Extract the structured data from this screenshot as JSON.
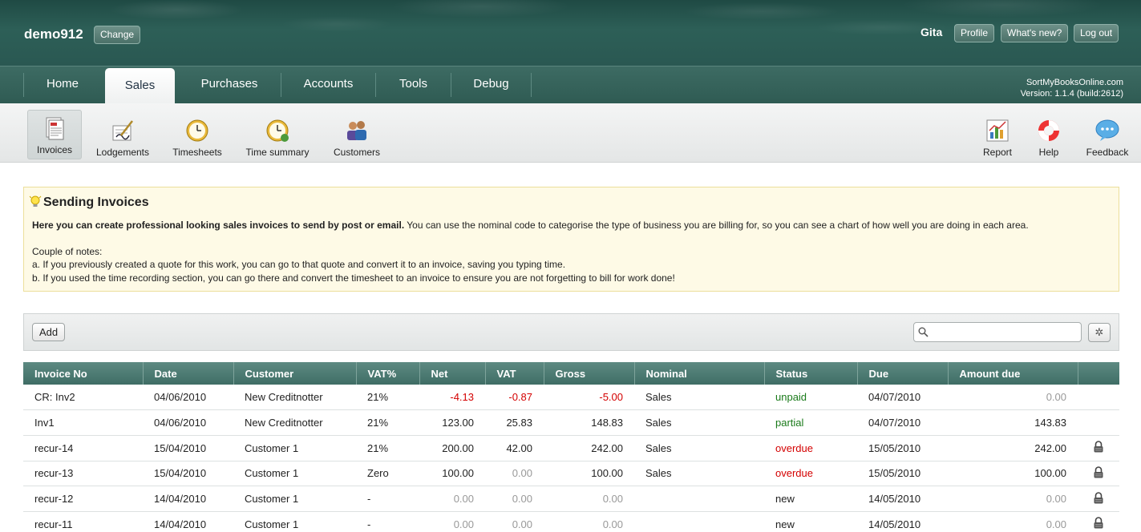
{
  "header": {
    "company": "demo912",
    "change_label": "Change",
    "user": "Gita",
    "profile_label": "Profile",
    "whats_new_label": "What's new?",
    "logout_label": "Log out"
  },
  "nav": {
    "tabs": [
      "Home",
      "Sales",
      "Purchases",
      "Accounts",
      "Tools",
      "Debug"
    ],
    "active": "Sales",
    "product": "SortMyBooksOnline.com",
    "version": "Version: 1.1.4 (build:2612)"
  },
  "toolbar": {
    "items": [
      {
        "label": "Invoices",
        "icon": "invoices-icon"
      },
      {
        "label": "Lodgements",
        "icon": "lodgements-icon"
      },
      {
        "label": "Timesheets",
        "icon": "clock-icon"
      },
      {
        "label": "Time summary",
        "icon": "clock-summary-icon"
      },
      {
        "label": "Customers",
        "icon": "customers-icon"
      }
    ],
    "right_items": [
      {
        "label": "Report",
        "icon": "report-chart-icon"
      },
      {
        "label": "Help",
        "icon": "lifebuoy-icon"
      },
      {
        "label": "Feedback",
        "icon": "speech-bubble-icon"
      }
    ]
  },
  "info": {
    "title": "Sending Invoices",
    "lead_bold": "Here you can create professional looking sales invoices to send by post or email.",
    "lead_rest": " You can use the nominal code to categorise the type of business you are billing for, so you can see a chart of how well you are doing in each area.",
    "notes_heading": "Couple of notes:",
    "note_a": "a. If you previously created a quote for this work, you can go to that quote and convert it to an invoice, saving you typing time.",
    "note_b": "b. If you used the time recording section, you can go there and convert the timesheet to an invoice to ensure you are not forgetting to bill for work done!"
  },
  "actions": {
    "add_label": "Add",
    "search_placeholder": ""
  },
  "table": {
    "columns": [
      "Invoice No",
      "Date",
      "Customer",
      "VAT%",
      "Net",
      "VAT",
      "Gross",
      "Nominal",
      "Status",
      "Due",
      "Amount due",
      ""
    ],
    "rows": [
      {
        "invoice": "CR: Inv2",
        "date": "04/06/2010",
        "customer": "New Creditnotter",
        "vat_pct": "21%",
        "net": "-4.13",
        "vat": "-0.87",
        "gross": "-5.00",
        "nominal": "Sales",
        "status": "unpaid",
        "due": "04/07/2010",
        "amount_due": "0.00",
        "locked": false
      },
      {
        "invoice": "Inv1",
        "date": "04/06/2010",
        "customer": "New Creditnotter",
        "vat_pct": "21%",
        "net": "123.00",
        "vat": "25.83",
        "gross": "148.83",
        "nominal": "Sales",
        "status": "partial",
        "due": "04/07/2010",
        "amount_due": "143.83",
        "locked": false
      },
      {
        "invoice": "recur-14",
        "date": "15/04/2010",
        "customer": "Customer 1",
        "vat_pct": "21%",
        "net": "200.00",
        "vat": "42.00",
        "gross": "242.00",
        "nominal": "Sales",
        "status": "overdue",
        "due": "15/05/2010",
        "amount_due": "242.00",
        "locked": true
      },
      {
        "invoice": "recur-13",
        "date": "15/04/2010",
        "customer": "Customer 1",
        "vat_pct": "Zero",
        "net": "100.00",
        "vat": "0.00",
        "gross": "100.00",
        "nominal": "Sales",
        "status": "overdue",
        "due": "15/05/2010",
        "amount_due": "100.00",
        "locked": true
      },
      {
        "invoice": "recur-12",
        "date": "14/04/2010",
        "customer": "Customer 1",
        "vat_pct": "-",
        "net": "0.00",
        "vat": "0.00",
        "gross": "0.00",
        "nominal": "",
        "status": "new",
        "due": "14/05/2010",
        "amount_due": "0.00",
        "locked": true
      },
      {
        "invoice": "recur-11",
        "date": "14/04/2010",
        "customer": "Customer 1",
        "vat_pct": "-",
        "net": "0.00",
        "vat": "0.00",
        "gross": "0.00",
        "nominal": "",
        "status": "new",
        "due": "14/05/2010",
        "amount_due": "0.00",
        "locked": true
      }
    ]
  },
  "colors": {
    "header_bg": "#2d5f57",
    "table_header": "#4f7c74",
    "negative": "#d40000",
    "status_green": "#1a7a1a",
    "status_red": "#d40000",
    "info_bg": "#fefae6"
  }
}
